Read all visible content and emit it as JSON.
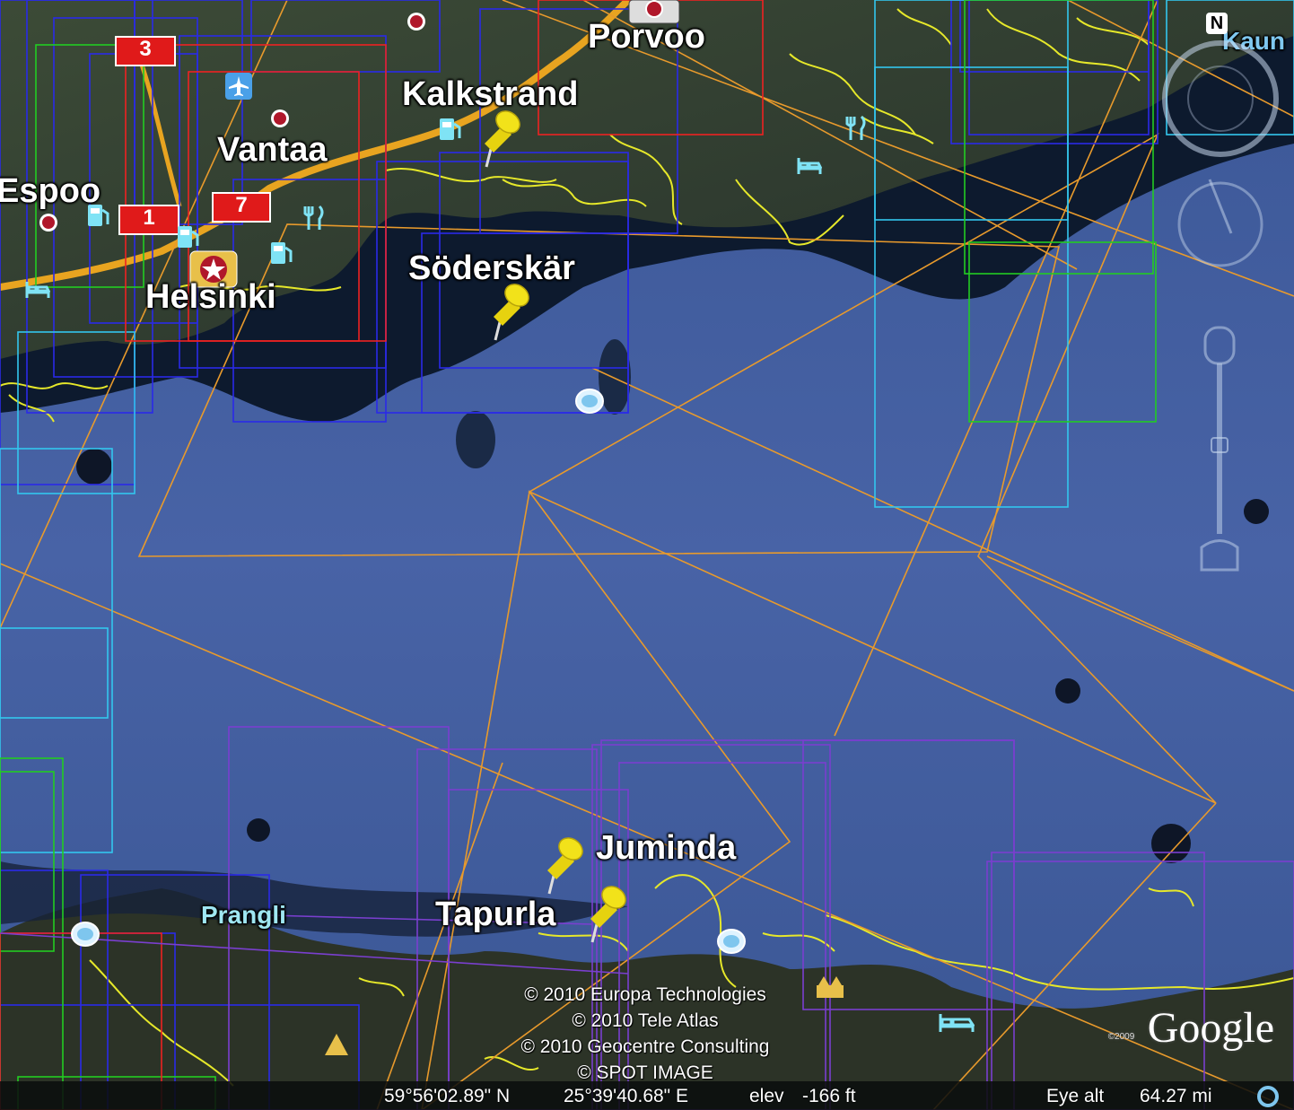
{
  "places": {
    "porvoo": "Porvoo",
    "kalkstrand": "Kalkstrand",
    "vantaa": "Vantaa",
    "espoo": "Espoo",
    "helsinki": "Helsinki",
    "soderskar": "Söderskär",
    "juminda": "Juminda",
    "tapurla": "Tapurla",
    "prangli": "Prangli",
    "kaun": "Kaun"
  },
  "road_shields": {
    "r3": "3",
    "r1": "1",
    "r7": "7"
  },
  "compass": {
    "north": "N"
  },
  "copyright": [
    "© 2010 Europa Technologies",
    "© 2010 Tele Atlas",
    "© 2010 Geocentre Consulting",
    "© SPOT IMAGE"
  ],
  "status": {
    "lat": "59°56'02.89\" N",
    "lon": "25°39'40.68\" E",
    "elev_label": "elev",
    "elev_value": "-166 ft",
    "eye_label": "Eye alt",
    "eye_value": "64.27 mi"
  },
  "brand": {
    "logo": "Google",
    "year": "©2009"
  },
  "colors": {
    "sea": "#3e5c9e",
    "land": "#2a3a2c",
    "coast": "#e6e82a",
    "pin": "#f2e21a",
    "orange": "#e89a2c",
    "blue": "#2222ee",
    "cyan": "#33c6ee",
    "green": "#22cc22",
    "red": "#ee2222",
    "violet": "#7a3fcf"
  }
}
